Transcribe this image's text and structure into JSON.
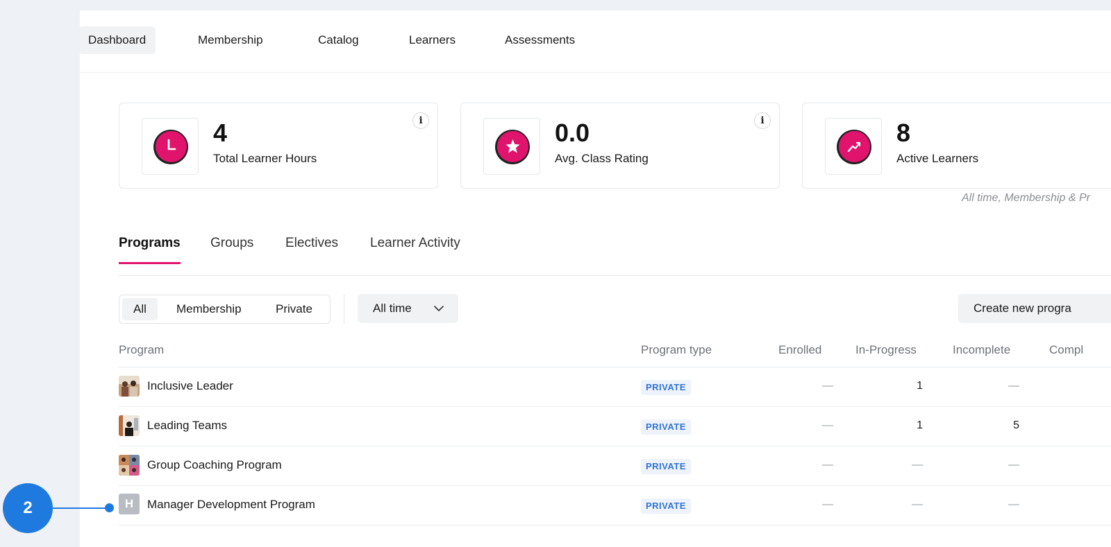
{
  "nav": {
    "items": [
      {
        "label": "Dashboard",
        "active": true
      },
      {
        "label": "Membership",
        "active": false
      },
      {
        "label": "Catalog",
        "active": false
      },
      {
        "label": "Learners",
        "active": false
      },
      {
        "label": "Assessments",
        "active": false
      }
    ]
  },
  "stats": [
    {
      "value": "4",
      "label": "Total Learner Hours",
      "icon": "clock-icon",
      "info": "i"
    },
    {
      "value": "0.0",
      "label": "Avg. Class Rating",
      "icon": "star-icon",
      "info": "i"
    },
    {
      "value": "8",
      "label": "Active Learners",
      "icon": "trend-icon",
      "info": "i"
    }
  ],
  "stats_footnote": "All time, Membership & Pr",
  "tabs": [
    {
      "label": "Programs",
      "active": true
    },
    {
      "label": "Groups",
      "active": false
    },
    {
      "label": "Electives",
      "active": false
    },
    {
      "label": "Learner Activity",
      "active": false
    }
  ],
  "filters": {
    "segments": [
      {
        "label": "All",
        "active": true
      },
      {
        "label": "Membership",
        "active": false
      },
      {
        "label": "Private",
        "active": false
      }
    ],
    "time_range": "All time",
    "create_label": "Create new progra"
  },
  "table": {
    "columns": [
      "Program",
      "Program type",
      "Enrolled",
      "In-Progress",
      "Incomplete",
      "Compl"
    ],
    "rows": [
      {
        "name": "Inclusive Leader",
        "type": "PRIVATE",
        "enrolled": "—",
        "in_progress": "1",
        "incomplete": "—",
        "thumb": "photo"
      },
      {
        "name": "Leading Teams",
        "type": "PRIVATE",
        "enrolled": "—",
        "in_progress": "1",
        "incomplete": "5",
        "thumb": "photo"
      },
      {
        "name": "Group Coaching Program",
        "type": "PRIVATE",
        "enrolled": "—",
        "in_progress": "—",
        "incomplete": "—",
        "thumb": "photo"
      },
      {
        "name": "Manager Development Program",
        "type": "PRIVATE",
        "enrolled": "—",
        "in_progress": "—",
        "incomplete": "—",
        "thumb": "H"
      }
    ]
  },
  "callout": {
    "number": "2"
  },
  "colors": {
    "accent": "#e0146d",
    "badge_text": "#2f73d8",
    "callout": "#1f7ae0"
  }
}
